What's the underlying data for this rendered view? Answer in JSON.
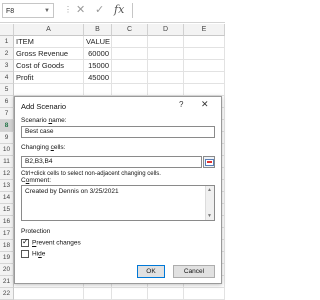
{
  "formula_bar": {
    "name_box": "F8",
    "fx": "fx"
  },
  "columns": [
    "A",
    "B",
    "C",
    "D",
    "E"
  ],
  "rows": [
    "1",
    "2",
    "3",
    "4",
    "5",
    "6",
    "7",
    "8",
    "9",
    "10",
    "11",
    "12",
    "13",
    "14",
    "15",
    "16",
    "17",
    "18",
    "19",
    "20",
    "21",
    "22"
  ],
  "cells": {
    "a1": "ITEM",
    "b1": "VALUE",
    "a2": "Gross Revenue",
    "b2": "60000",
    "a3": "Cost of Goods",
    "b3": "15000",
    "a4": "Profit",
    "b4": "45000"
  },
  "dialog": {
    "title": "Add Scenario",
    "help": "?",
    "close": "✕",
    "scenario_name_label": "Scenario name:",
    "scenario_name_value": "Best case",
    "changing_cells_label": "Changing cells:",
    "changing_cells_value": "B2,B3,B4",
    "hint": "Ctrl+click cells to select non-adjacent changing cells.",
    "comment_label": "Comment:",
    "comment_value": "Created by Dennis on 3/25/2021",
    "protection_label": "Protection",
    "prevent_changes_label": "Prevent changes",
    "prevent_changes_checked": true,
    "hide_label": "Hide",
    "hide_checked": false,
    "ok_label": "OK",
    "cancel_label": "Cancel"
  },
  "colors": {
    "selected_row_text": "#217346",
    "default_button_border": "#0078d7"
  }
}
